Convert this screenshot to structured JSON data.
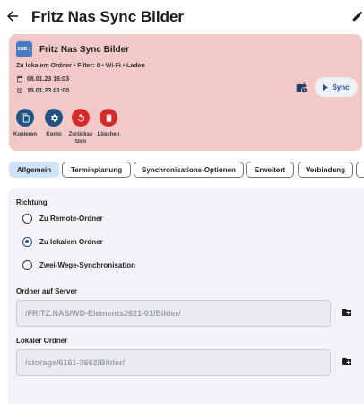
{
  "header": {
    "title": "Fritz Nas Sync Bilder",
    "back_icon": "arrow-back-icon",
    "edit_icon": "pencil-icon"
  },
  "card": {
    "background": "#f2c8c8",
    "badge": "SMB 1",
    "title": "Fritz Nas Sync Bilder",
    "meta": "Zu lokalem Ordner • Filter: 0 • Wi-Fi • Laden",
    "last_sync": "08.01.23 16:03",
    "next_sync": "15.01.23 01:00",
    "sync_label": "Sync",
    "actions": [
      {
        "label": "Kopieren",
        "icon": "copy-icon"
      },
      {
        "label": "Konto",
        "icon": "settings-icon"
      },
      {
        "label": "Zurückse tzen",
        "icon": "reset-icon"
      },
      {
        "label": "Löschen",
        "icon": "trash-icon"
      }
    ]
  },
  "tabs": [
    {
      "label": "Allgemein",
      "active": true
    },
    {
      "label": "Terminplanung"
    },
    {
      "label": "Synchronisations-Optionen"
    },
    {
      "label": "Erweitert"
    },
    {
      "label": "Verbindung"
    }
  ],
  "form": {
    "direction_label": "Richtung",
    "options": [
      "Zu Remote-Ordner",
      "Zu lokalem Ordner",
      "Zwei-Wege-Synchronisation"
    ],
    "selected_option": "Zu lokalem Ordner",
    "server_folder_label": "Ordner auf Server",
    "server_folder_value": "/FRITZ.NAS/WD-Elements2621-01/Bilder/",
    "local_folder_label": "Lokaler Ordner",
    "local_folder_value": "/storage/6161-3662/Bilder/"
  },
  "colors": {
    "accent": "#1e4a8a",
    "action_blue": "#1e5580",
    "action_red": "#d42a2a",
    "tab_active": "#cfe3f6"
  }
}
